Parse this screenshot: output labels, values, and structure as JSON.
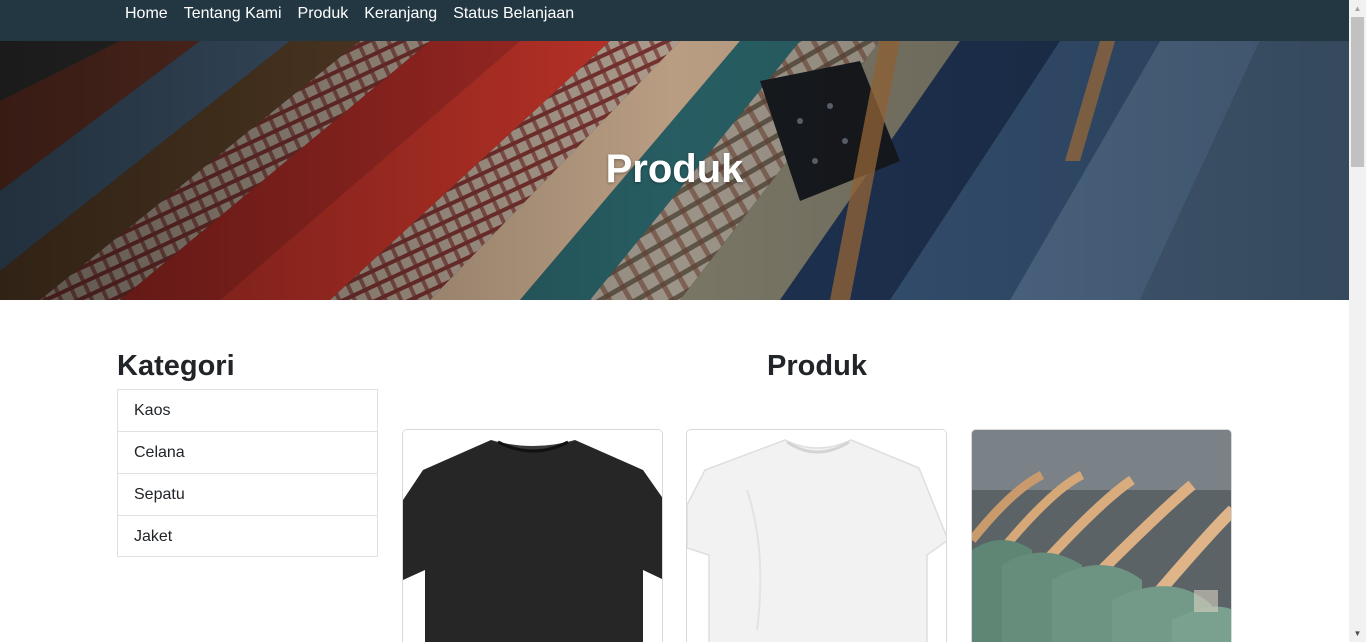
{
  "nav": {
    "items": [
      "Home",
      "Tentang Kami",
      "Produk",
      "Keranjang",
      "Status Belanjaan"
    ]
  },
  "hero": {
    "title": "Produk"
  },
  "categories": {
    "title": "Kategori",
    "items": [
      "Kaos",
      "Celana",
      "Sepatu",
      "Jaket"
    ]
  },
  "products": {
    "title": "Produk"
  },
  "colors": {
    "navbar": "#233743",
    "text": "#212529",
    "border": "#dee2e6"
  }
}
